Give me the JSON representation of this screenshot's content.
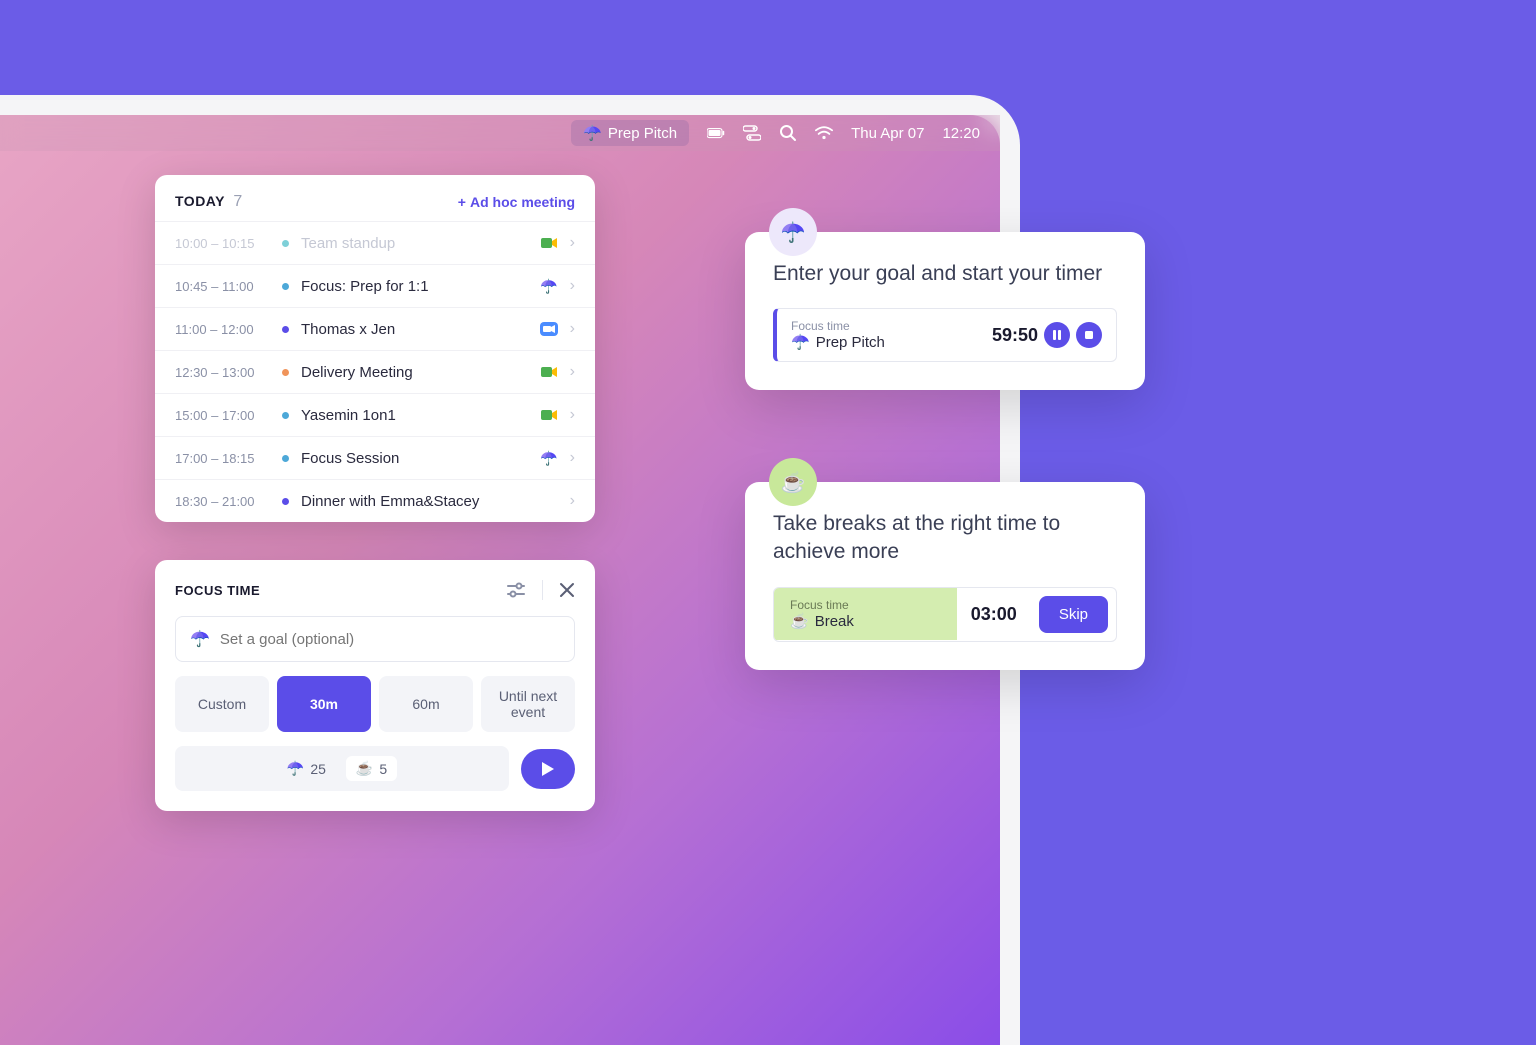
{
  "menubar": {
    "app_task": "Prep Pitch",
    "date": "Thu Apr 07",
    "time": "12:20"
  },
  "today": {
    "title": "TODAY",
    "count": "7",
    "adhoc_label": "Ad hoc meeting",
    "events": [
      {
        "time": "10:00 – 10:15",
        "title": "Team standup",
        "dot": "#7ed0d8",
        "icon": "meet",
        "past": true
      },
      {
        "time": "10:45 – 11:00",
        "title": "Focus: Prep for 1:1",
        "dot": "#4da8d8",
        "icon": "umbrella"
      },
      {
        "time": "11:00 – 12:00",
        "title": "Thomas x Jen",
        "dot": "#5b4de8",
        "icon": "zoom"
      },
      {
        "time": "12:30 – 13:00",
        "title": "Delivery Meeting",
        "dot": "#f0945a",
        "icon": "meet"
      },
      {
        "time": "15:00 – 17:00",
        "title": "Yasemin 1on1",
        "dot": "#4da8d8",
        "icon": "meet"
      },
      {
        "time": "17:00 – 18:15",
        "title": "Focus Session",
        "dot": "#4da8d8",
        "icon": "umbrella"
      },
      {
        "time": "18:30 – 21:00",
        "title": "Dinner with Emma&Stacey",
        "dot": "#5b4de8",
        "icon": ""
      }
    ]
  },
  "focus": {
    "title": "FOCUS TIME",
    "goal_placeholder": "Set a goal (optional)",
    "durations": [
      "Custom",
      "30m",
      "60m",
      "Until next event"
    ],
    "active_duration": 1,
    "umbrella_count": "25",
    "coffee_count": "5"
  },
  "timer_card": {
    "heading": "Enter your goal and start your timer",
    "label": "Focus time",
    "task": "Prep Pitch",
    "time": "59:50"
  },
  "break_card": {
    "heading": "Take breaks at the right time to achieve more",
    "label": "Focus time",
    "task": "Break",
    "time": "03:00",
    "skip_label": "Skip"
  },
  "colors": {
    "accent": "#5b4de8"
  }
}
